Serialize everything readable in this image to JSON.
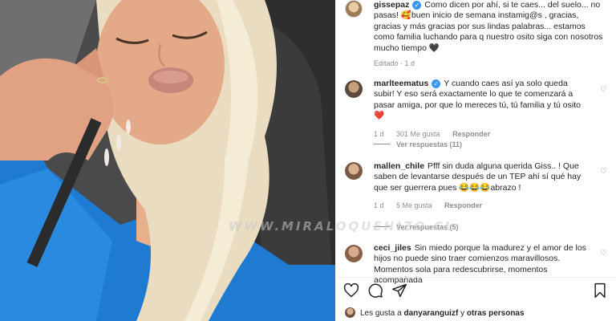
{
  "caption": {
    "username": "gissepaz",
    "text": "Como dicen por ahí, si te caes... del suelo... no pasas! 🥰buen inicio de semana instamig@s , gracias, gracias y más gracias por sus lindas palabras... estamos como familia luchando para q nuestro osito siga con nosotros mucho tiempo 🖤",
    "meta": "Editado · 1 d"
  },
  "comments": [
    {
      "username": "marlteematus",
      "verified": true,
      "text": "Y cuando caes así ya solo queda subir! Y eso será exactamente lo que te comenzará a pasar amiga, por que lo mereces tú, tú familia y tú osito❤️",
      "time": "1 d",
      "likes": "301 Me gusta",
      "reply": "Responder",
      "view_replies": "Ver respuestas (11)"
    },
    {
      "username": "mallen_chile",
      "verified": false,
      "text": "Pfff sin duda alguna querida Giss.. ! Que saben de levantarse después de un TEP ahí sí qué hay que ser guerrera pues 😂😂😂abrazo !",
      "time": "1 d",
      "likes": "5 Me gusta",
      "reply": "Responder",
      "view_replies": "Ver respuestas (5)"
    },
    {
      "username": "ceci_jiles",
      "verified": false,
      "text": "Sin miedo porque la madurez y el amor de los hijos no puede sino traer comienzos maravillosos. Momentos sola para redescubrirse, momentos acompañada"
    }
  ],
  "likes_line": {
    "prefix": "Les gusta a",
    "user": "danyaranguizf",
    "suffix": "y",
    "others": "otras personas"
  },
  "watermark": "WWW.MIRALOQUEHIZO.CL",
  "icons": {
    "like": "heart-icon",
    "comment": "comment-icon",
    "share": "share-icon",
    "save": "bookmark-icon"
  },
  "colors": {
    "verified": "#3897f0",
    "like_red": "#ed4956",
    "muted": "#8e8e8e",
    "text": "#262626"
  }
}
